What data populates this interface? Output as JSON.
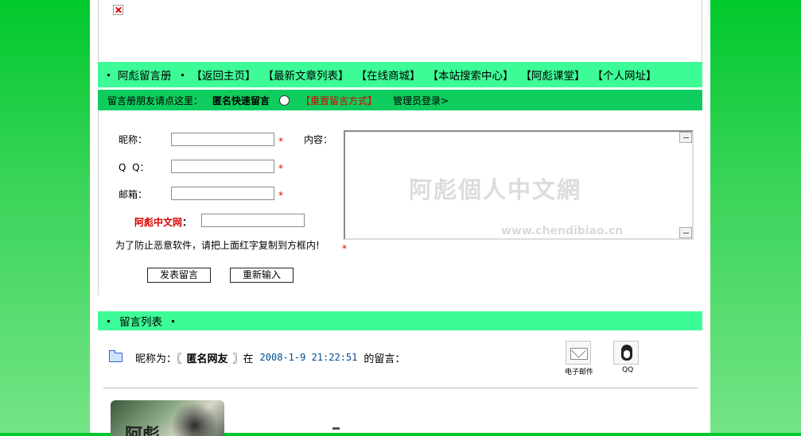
{
  "nav": {
    "title": "阿彪留言册",
    "links": [
      "【返回主页】",
      "【最新文章列表】",
      "【在线商城】",
      "【本站搜索中心】",
      "【阿彪课堂】",
      "【个人网址】"
    ]
  },
  "subbar": {
    "hint": "留言册朋友请点这里：",
    "anonymous": "匿名快速留言",
    "reset_mode": "【重置留言方式】",
    "admin_login": "管理员登录>"
  },
  "form": {
    "nickname_label": "昵称：",
    "qq_label": "Q  Q：",
    "email_label": "邮箱：",
    "content_label": "内容：",
    "captcha_label": "阿彪中文网",
    "captcha_colon": "：",
    "required_mark": "*",
    "antispam_note": "为了防止恶意软件，请把上面红字复制到方框内!",
    "submit_label": "发表留言",
    "reset_label": "重新输入",
    "nickname_value": "",
    "qq_value": "",
    "email_value": "",
    "captcha_value": "",
    "watermark_text": "阿彪個人中文網",
    "watermark_url": "www.chendibiao.cn"
  },
  "list": {
    "title": "留言列表"
  },
  "message": {
    "prefix": "昵称为：〖",
    "name": "匿名网友",
    "suffix": "〗在",
    "date": "2008-1-9 21:22:51",
    "end": "的留言：",
    "email_icon_label": "电子邮件",
    "qq_icon_label": "QQ"
  },
  "avatar_text": "阿彪"
}
